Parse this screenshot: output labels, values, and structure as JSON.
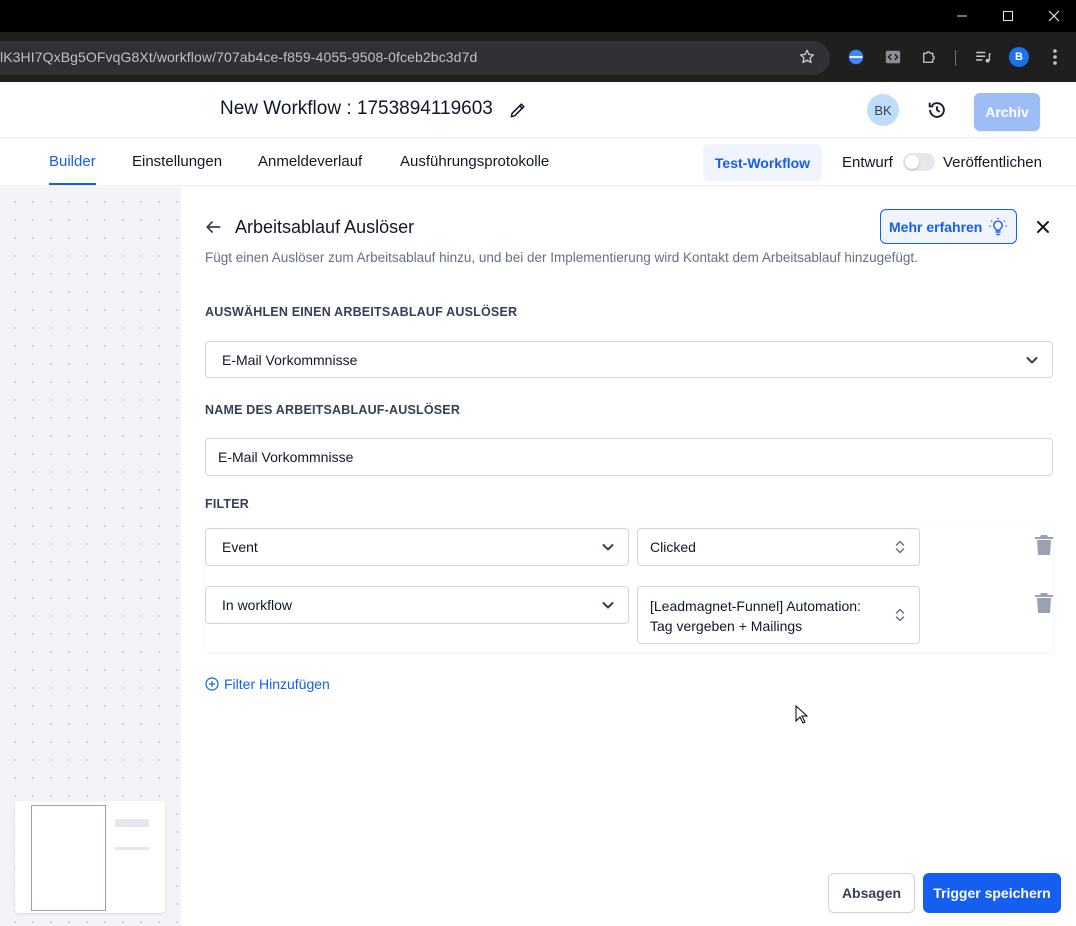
{
  "browser": {
    "url": "lK3HI7QxBg5OFvqG8Xt/workflow/707ab4ce-f859-4055-9508-0fceb2bc3d7d",
    "profile_initial": "B"
  },
  "header": {
    "title": "New Workflow : 1753894119603",
    "avatar_initials": "BK",
    "archive_label": "Archiv"
  },
  "tabs": [
    {
      "label": "Builder",
      "active": true
    },
    {
      "label": "Einstellungen",
      "active": false
    },
    {
      "label": "Anmeldeverlauf",
      "active": false
    },
    {
      "label": "Ausführungsprotokolle",
      "active": false
    }
  ],
  "actions": {
    "test_label": "Test-Workflow",
    "draft_label": "Entwurf",
    "publish_label": "Veröffentlichen",
    "published": false
  },
  "panel": {
    "title": "Arbeitsablauf Auslöser",
    "learn_more": "Mehr erfahren",
    "description": "Fügt einen Auslöser zum Arbeitsablauf hinzu, und bei der Implementierung wird Kontakt dem Arbeitsablauf hinzugefügt.",
    "trigger_section_label": "AUSWÄHLEN EINEN ARBEITSABLAUF AUSLÖSER",
    "trigger_value": "E-Mail Vorkommnisse",
    "name_section_label": "NAME DES ARBEITSABLAUF-AUSLÖSER",
    "name_value": "E-Mail Vorkommnisse",
    "filter_section_label": "FILTER",
    "filters": [
      {
        "field": "Event",
        "value_lines": [
          "Clicked"
        ]
      },
      {
        "field": "In workflow",
        "value_lines": [
          "[Leadmagnet-Funnel] Automation:",
          "Tag vergeben + Mailings"
        ]
      }
    ],
    "add_filter_label": "Filter Hinzufügen",
    "cancel_label": "Absagen",
    "save_label": "Trigger speichern"
  },
  "colors": {
    "primary": "#155eef",
    "primary_light": "#eff4ff",
    "archive_disabled": "#9dbdf7",
    "canvas_bg": "#f2f4f7"
  }
}
